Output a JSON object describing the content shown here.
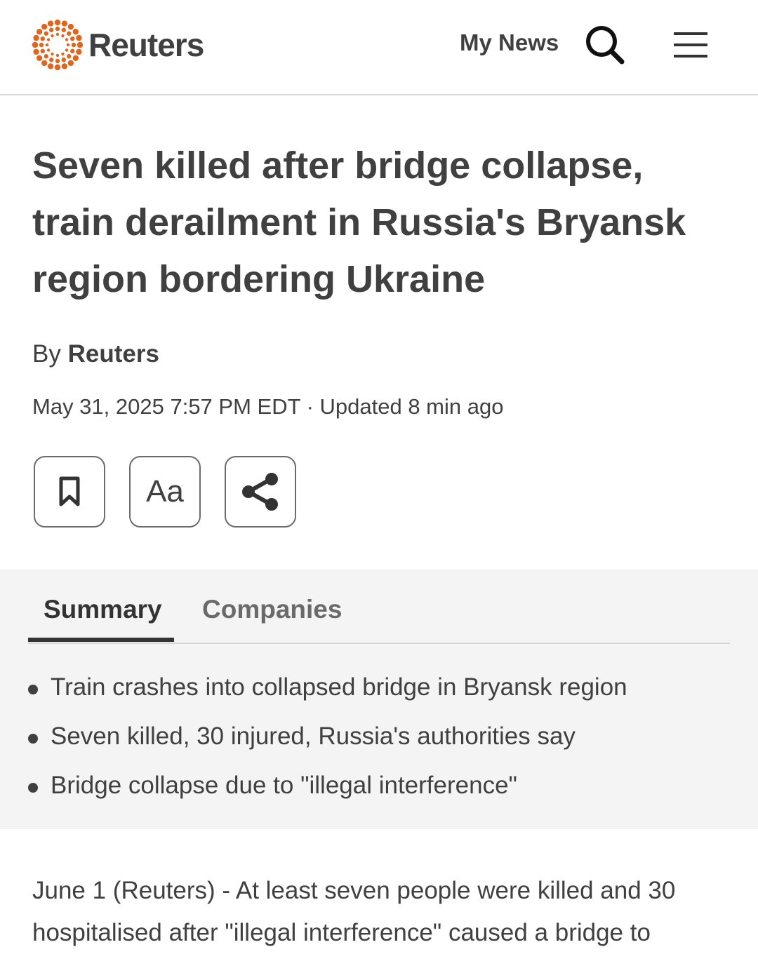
{
  "header": {
    "brand": "Reuters",
    "logo_icon": "reuters-dot-ring-logo",
    "my_news_label": "My News",
    "search_icon": "search-icon",
    "menu_icon": "hamburger-menu-icon"
  },
  "article": {
    "headline": "Seven killed after bridge collapse, train derailment in Russia's Bryansk region bordering Ukraine",
    "byline_prefix": "By",
    "byline_author": "Reuters",
    "dateline": "May 31, 2025 7:57 PM EDT · Updated 8 min ago",
    "tools": {
      "bookmark_icon": "bookmark-icon",
      "font_size_label": "Aa",
      "share_icon": "share-icon"
    },
    "tabs": [
      {
        "label": "Summary",
        "active": true
      },
      {
        "label": "Companies",
        "active": false
      }
    ],
    "summary": [
      "Train crashes into collapsed bridge in Bryansk region",
      "Seven killed, 30 injured, Russia's authorities say",
      "Bridge collapse due to \"illegal interference\""
    ],
    "body_first_paragraph": "June 1 (Reuters) - At least seven people were killed and 30 hospitalised after \"illegal interference\" caused a bridge to"
  },
  "colors": {
    "logo_orange": "#e2651e",
    "text": "#404040",
    "summary_background": "#f4f4f4"
  }
}
